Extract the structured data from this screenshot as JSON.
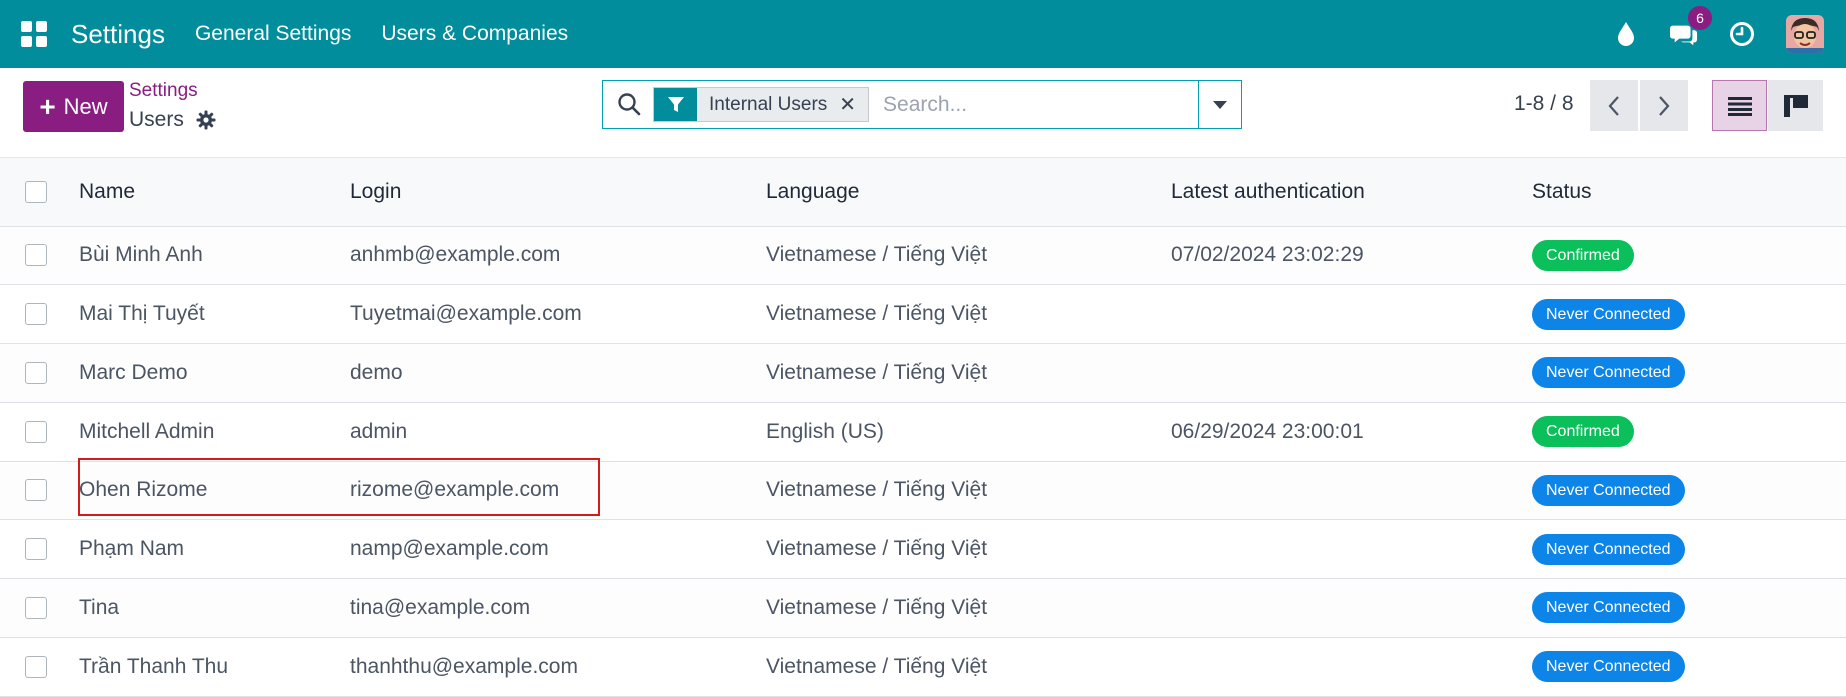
{
  "navbar": {
    "app_name": "Settings",
    "menu": [
      "General Settings",
      "Users & Companies"
    ],
    "icons": [
      "apps-grid-icon",
      "water-drop-icon",
      "chat-bubbles-icon",
      "clock-icon",
      "user-avatar"
    ],
    "messages_badge": "6"
  },
  "control_panel": {
    "new_label": "New",
    "breadcrumb_parent": "Settings",
    "breadcrumb_current": "Users",
    "search": {
      "facet_label": "Internal Users",
      "facet_remove": "✕",
      "placeholder": "Search..."
    },
    "pager": "1-8 / 8"
  },
  "table": {
    "headers": [
      "Name",
      "Login",
      "Language",
      "Latest authentication",
      "Status"
    ],
    "rows": [
      {
        "name": "Bùi Minh Anh",
        "login": "anhmb@example.com",
        "language": "Vietnamese / Tiếng Việt",
        "latest_auth": "07/02/2024 23:02:29",
        "status": "Confirmed"
      },
      {
        "name": "Mai Thị Tuyết",
        "login": "Tuyetmai@example.com",
        "language": "Vietnamese / Tiếng Việt",
        "latest_auth": "",
        "status": "Never Connected"
      },
      {
        "name": "Marc Demo",
        "login": "demo",
        "language": "Vietnamese / Tiếng Việt",
        "latest_auth": "",
        "status": "Never Connected"
      },
      {
        "name": "Mitchell Admin",
        "login": "admin",
        "language": "English (US)",
        "latest_auth": "06/29/2024 23:00:01",
        "status": "Confirmed"
      },
      {
        "name": "Ohen Rizome",
        "login": "rizome@example.com",
        "language": "Vietnamese / Tiếng Việt",
        "latest_auth": "",
        "status": "Never Connected"
      },
      {
        "name": "Phạm Nam",
        "login": "namp@example.com",
        "language": "Vietnamese / Tiếng Việt",
        "latest_auth": "",
        "status": "Never Connected"
      },
      {
        "name": "Tina",
        "login": "tina@example.com",
        "language": "Vietnamese / Tiếng Việt",
        "latest_auth": "",
        "status": "Never Connected"
      },
      {
        "name": "Trần Thanh Thu",
        "login": "thanhthu@example.com",
        "language": "Vietnamese / Tiếng Việt",
        "latest_auth": "",
        "status": "Never Connected"
      }
    ]
  },
  "colors": {
    "navbar": "#018d9b",
    "primary": "#8a1d82",
    "confirmed": "#0bbf5b",
    "never_connected": "#0d84e8",
    "highlight_box": "#d21b1b"
  }
}
